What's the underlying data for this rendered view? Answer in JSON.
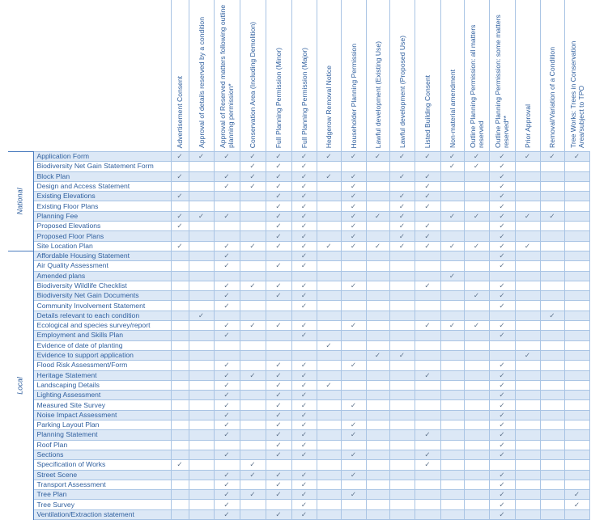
{
  "columns": [
    "Advertisement Consent",
    "Approval of details reserved by a condition",
    "Approval of Reserved matters following outline planning permission*",
    "Conservation Area (Including Demolition)",
    "Full Planning Permission (Minor)",
    "Full Planning Permission (Major)",
    "Hedgerow Removal Notice",
    "Householder Planning Permission",
    "Lawful development (Existing Use)",
    "Lawful development (Proposed Use)",
    "Listed Building Consent",
    "Non-material amendment",
    "Outline Planning Permission: all matters reserved",
    "Outline Planning Permission: some matters reserved**",
    "Prior Approval",
    "Removal/Variation of a Condition",
    "Tree Works: Trees in Conservation Area/subject to TPO"
  ],
  "check_symbol": "✓",
  "colors": {
    "text": "#2f5f9e",
    "row_shade": "#dce8f6",
    "grid": "#a9c4e4"
  },
  "groups": [
    {
      "label": "National",
      "rows": [
        {
          "label": "Application Form",
          "checks": [
            0,
            1,
            2,
            3,
            4,
            5,
            6,
            7,
            8,
            9,
            10,
            11,
            12,
            13,
            14,
            15,
            16
          ]
        },
        {
          "label": "Biodiversity Net Gain Statement Form",
          "checks": [
            3,
            4,
            5,
            11,
            12,
            13
          ]
        },
        {
          "label": "Block Plan",
          "checks": [
            0,
            2,
            3,
            4,
            5,
            6,
            7,
            9,
            10,
            13
          ]
        },
        {
          "label": "Design and Access Statement",
          "checks": [
            2,
            3,
            4,
            5,
            7,
            10,
            13
          ]
        },
        {
          "label": "Existing Elevations",
          "checks": [
            0,
            4,
            5,
            7,
            9,
            10,
            13
          ]
        },
        {
          "label": "Existing Floor Plans",
          "checks": [
            4,
            5,
            7,
            9,
            10,
            13
          ]
        },
        {
          "label": "Planning Fee",
          "checks": [
            0,
            1,
            2,
            4,
            5,
            7,
            8,
            9,
            11,
            12,
            13,
            14,
            15
          ]
        },
        {
          "label": "Proposed Elevations",
          "checks": [
            0,
            4,
            5,
            7,
            9,
            10,
            13
          ]
        },
        {
          "label": "Proposed Floor Plans",
          "checks": [
            4,
            5,
            7,
            9,
            10,
            13
          ]
        },
        {
          "label": "Site Location Plan",
          "checks": [
            0,
            2,
            3,
            4,
            5,
            6,
            7,
            8,
            9,
            10,
            11,
            12,
            13,
            14
          ]
        }
      ]
    },
    {
      "label": "Local",
      "rows": [
        {
          "label": "Affordable Housing Statement",
          "checks": [
            2,
            5,
            13
          ]
        },
        {
          "label": "Air Quality Assessment",
          "checks": [
            2,
            4,
            5,
            13
          ]
        },
        {
          "label": "Amended plans",
          "checks": [
            11
          ]
        },
        {
          "label": "Biodiversity Wildlife Checklist",
          "checks": [
            2,
            3,
            4,
            5,
            7,
            10,
            13
          ]
        },
        {
          "label": "Biodiversity Net Gain Documents",
          "checks": [
            2,
            4,
            5,
            12,
            13
          ]
        },
        {
          "label": "Community Involvement Statement",
          "checks": [
            2,
            5,
            13
          ]
        },
        {
          "label": "Details relevant to each condition",
          "checks": [
            1,
            15
          ]
        },
        {
          "label": "Ecological and species survey/report",
          "checks": [
            2,
            3,
            4,
            5,
            7,
            10,
            11,
            12,
            13
          ]
        },
        {
          "label": "Employment and Skills Plan",
          "checks": [
            2,
            5,
            13
          ]
        },
        {
          "label": "Evidence of date of planting",
          "checks": [
            6
          ]
        },
        {
          "label": "Evidence to support application",
          "checks": [
            8,
            9,
            14
          ]
        },
        {
          "label": "Flood Risk Assessment/Form",
          "checks": [
            2,
            4,
            5,
            7,
            13
          ]
        },
        {
          "label": "Heritage Statement",
          "checks": [
            2,
            3,
            4,
            5,
            10,
            13
          ]
        },
        {
          "label": "Landscaping Details",
          "checks": [
            2,
            4,
            5,
            6,
            13
          ]
        },
        {
          "label": "Lighting Assessment",
          "checks": [
            2,
            4,
            5,
            13
          ]
        },
        {
          "label": "Measured Site Survey",
          "checks": [
            2,
            4,
            5,
            7,
            13
          ]
        },
        {
          "label": "Noise Impact Assessment",
          "checks": [
            2,
            4,
            5,
            13
          ]
        },
        {
          "label": "Parking Layout Plan",
          "checks": [
            2,
            4,
            5,
            7,
            13
          ]
        },
        {
          "label": "Planning Statement",
          "checks": [
            2,
            4,
            5,
            7,
            10,
            13
          ]
        },
        {
          "label": "Roof Plan",
          "checks": [
            4,
            5,
            13
          ]
        },
        {
          "label": "Sections",
          "checks": [
            2,
            4,
            5,
            7,
            10,
            13
          ]
        },
        {
          "label": "Specification of Works",
          "checks": [
            0,
            3,
            10
          ]
        },
        {
          "label": "Street Scene",
          "checks": [
            2,
            3,
            4,
            5,
            7,
            13
          ]
        },
        {
          "label": "Transport Assessment",
          "checks": [
            2,
            4,
            5,
            13
          ]
        },
        {
          "label": "Tree Plan",
          "checks": [
            2,
            3,
            4,
            5,
            7,
            13,
            16
          ]
        },
        {
          "label": "Tree Survey",
          "checks": [
            2,
            5,
            13,
            16
          ]
        },
        {
          "label": "Ventilation/Extraction statement",
          "checks": [
            2,
            4,
            5,
            13
          ]
        }
      ]
    }
  ]
}
